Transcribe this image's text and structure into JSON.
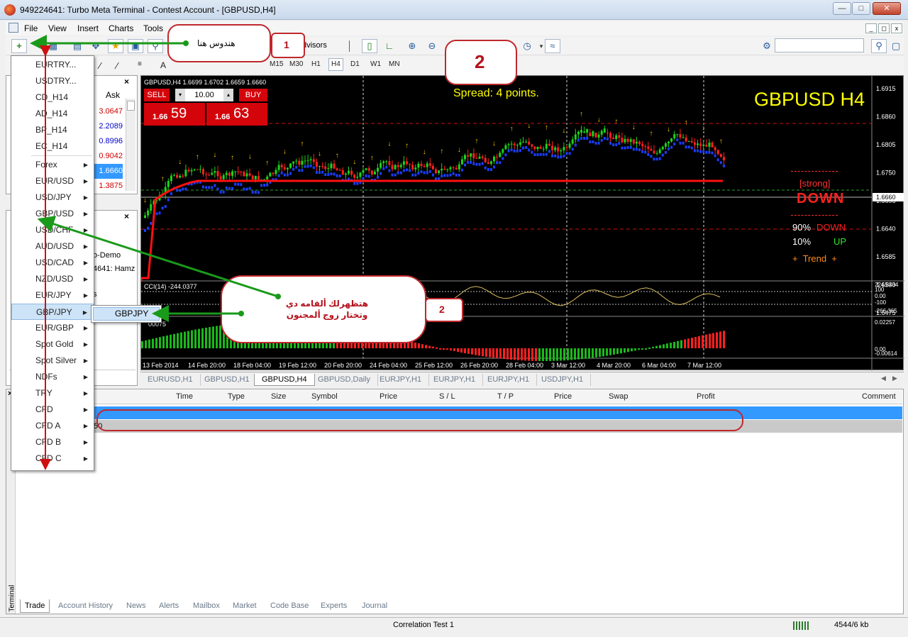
{
  "window": {
    "title": "949224641: Turbo Meta Terminal - Contest Account - [GBPUSD,H4]",
    "min": "—",
    "max": "□",
    "close": "✕"
  },
  "menu": [
    "File",
    "View",
    "Insert",
    "Charts",
    "Tools"
  ],
  "toolbar": {
    "advisors": "dvisors"
  },
  "timeframes": [
    "M15",
    "M30",
    "H1",
    "H4",
    "D1",
    "W1",
    "MN"
  ],
  "market_watch": {
    "ask_header": "Ask",
    "asks": [
      "3.0647",
      "2.2089",
      "0.8996",
      "0.9042",
      "1.6660",
      "1.3875"
    ]
  },
  "navigator": {
    "lines": [
      "o-Demo",
      "4641: Hamz",
      "s"
    ]
  },
  "dropdown": {
    "items": [
      "EURTRY...",
      "USDTRY...",
      "CD_H14",
      "AD_H14",
      "BP_H14",
      "EC_H14",
      "Forex",
      "EUR/USD",
      "USD/JPY",
      "GBP/USD",
      "USD/CHF",
      "AUD/USD",
      "USD/CAD",
      "NZD/USD",
      "EUR/JPY",
      "GBP/JPY",
      "EUR/GBP",
      "Spot Gold",
      "Spot Silver",
      "NDFs",
      "TRY",
      "CFD",
      "CFD A",
      "CFD B",
      "CFD C"
    ],
    "submenu_item": "GBPJPY"
  },
  "chart": {
    "header": "GBPUSD,H4  1.6699 1.6702 1.6659 1.6660",
    "sell_label": "SELL",
    "buy_label": "BUY",
    "lot": "10.00",
    "sell_price_small": "1.66",
    "sell_price_big": "59",
    "buy_price_small": "1.66",
    "buy_price_big": "63",
    "spread": "Spread: 4 points.",
    "symbol_big": "GBPUSD H4",
    "strong": "[strong]",
    "down": "DOWN",
    "pct_down": "90%",
    "pct_down_label": "DOWN",
    "pct_up": "10%",
    "pct_up_label": "UP",
    "trend": "+  Trend  +",
    "price_axis": [
      "1.6915",
      "1.6860",
      "1.6805",
      "1.6750",
      "1.6695",
      "1.6640",
      "1.6585",
      "1.6530",
      "1.6475"
    ],
    "current_price": "1.6660",
    "cci_label": "CCI(14) -244.0377",
    "cci_axis": [
      "224.8434",
      "100",
      "0.00",
      "-100",
      "-266.365"
    ],
    "osc_label": "00075",
    "osc_axis": [
      "0.02257",
      "0.00",
      "-0.00614"
    ],
    "dates": [
      "13 Feb 2014",
      "14 Feb 20:00",
      "18 Feb 04:00",
      "19 Feb 12:00",
      "20 Feb 20:00",
      "24 Feb 04:00",
      "25 Feb 12:00",
      "26 Feb 20:00",
      "28 Feb 04:00",
      "3 Mar 12:00",
      "4 Mar 20:00",
      "6 Mar 04:00",
      "7 Mar 12:00"
    ]
  },
  "chart_tabs": [
    "EURUSD,H1",
    "GBPUSD,H1",
    "GBPUSD,H4",
    "GBPUSD,Daily",
    "EURJPY,H1",
    "EURJPY,H1",
    "EURJPY,H1",
    "USDJPY,H1"
  ],
  "terminal": {
    "headers": [
      "Time",
      "Type",
      "Size",
      "Symbol",
      "Price",
      "S / L",
      "T / P",
      "Price",
      "Swap",
      "Profit",
      "Comment"
    ],
    "row2_frag": "50",
    "tabs": [
      "Trade",
      "Account History",
      "News",
      "Alerts",
      "Mailbox",
      "Market",
      "Code Base",
      "Experts",
      "Journal"
    ],
    "side_label": "Terminal"
  },
  "status": {
    "profile": "Correlation Test 1",
    "traffic": "4544/6 kb"
  },
  "annotations": {
    "c1_text": "هندوس هنا",
    "c1_num": "1",
    "c2_num": "2",
    "c3_text": "هتظهرلك ألقامه دي وتختار زوج ألمجنون",
    "c3_num": "2"
  }
}
